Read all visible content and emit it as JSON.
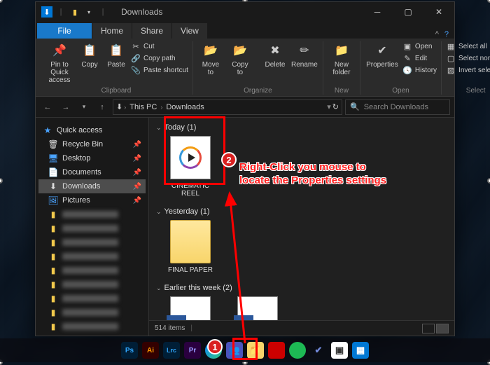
{
  "window": {
    "title": "Downloads"
  },
  "tabs": {
    "file": "File",
    "home": "Home",
    "share": "Share",
    "view": "View"
  },
  "ribbon": {
    "clipboard": {
      "label": "Clipboard",
      "pin": "Pin to Quick access",
      "copy": "Copy",
      "paste": "Paste",
      "cut": "Cut",
      "copypath": "Copy path",
      "shortcut": "Paste shortcut"
    },
    "organize": {
      "label": "Organize",
      "moveto": "Move to",
      "copyto": "Copy to",
      "delete": "Delete",
      "rename": "Rename"
    },
    "new": {
      "label": "New",
      "newfolder": "New folder"
    },
    "open": {
      "label": "Open",
      "properties": "Properties",
      "open": "Open",
      "edit": "Edit",
      "history": "History"
    },
    "select": {
      "label": "Select",
      "all": "Select all",
      "none": "Select none",
      "invert": "Invert selection"
    }
  },
  "address": {
    "crumbs": [
      "This PC",
      "Downloads"
    ],
    "search_placeholder": "Search Downloads",
    "refresh": "↻"
  },
  "sidebar": {
    "quick_access": "Quick access",
    "items": [
      {
        "label": "Recycle Bin",
        "icon": "🗑",
        "pin": true
      },
      {
        "label": "Desktop",
        "icon": "🖥",
        "pin": true
      },
      {
        "label": "Documents",
        "icon": "📄",
        "pin": true
      },
      {
        "label": "Downloads",
        "icon": "⬇",
        "pin": true,
        "selected": true
      },
      {
        "label": "Pictures",
        "icon": "🖼",
        "pin": true
      }
    ]
  },
  "groups": {
    "today": {
      "header": "Today (1)",
      "files": [
        "CINEMATIC REEL"
      ]
    },
    "yesterday": {
      "header": "Yesterday (1)",
      "files": [
        "FINAL PAPER"
      ]
    },
    "earlier": {
      "header": "Earlier this week (2)"
    }
  },
  "status": {
    "count": "514 items"
  },
  "annot": {
    "badge1": "1",
    "badge2": "2",
    "text_l1": "Right-Click you mouse to",
    "text_l2": "locate the Properties settings"
  },
  "taskbar_apps": [
    "Ps",
    "Ai",
    "Lrc",
    "Pr",
    "E",
    "T",
    "📁",
    "✕",
    "●",
    "✔",
    "📊",
    "📈"
  ]
}
